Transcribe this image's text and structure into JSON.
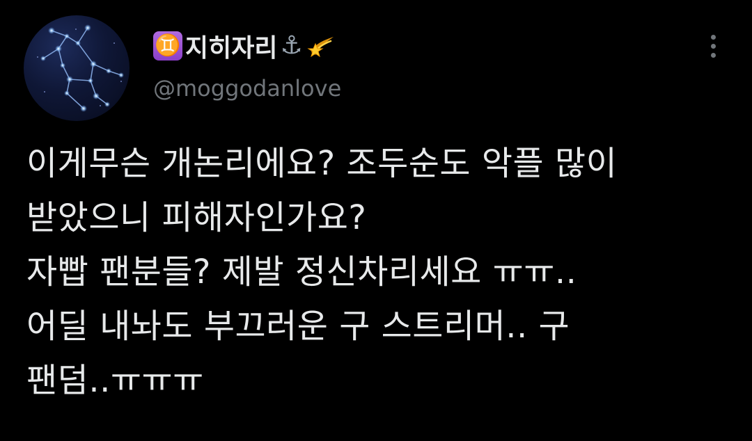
{
  "author": {
    "display_name": "♊지히자리⚓💫",
    "name_badge": "♊",
    "name_text": "지히자리",
    "name_anchor": "⚓",
    "name_emoji_icon": "dizzy-icon",
    "handle": "@moggodanlove",
    "avatar_icon": "gemini-constellation-avatar"
  },
  "menu": {
    "icon": "more-vertical-icon"
  },
  "tweet": {
    "lines": [
      "이게무슨 개논리에요? 조두순도 악플 많이",
      "받았으니 피해자인가요?",
      "자빱 팬분들? 제발 정신차리세요 ㅠㅠ..",
      "어딜 내놔도 부끄러운 구 스트리머.. 구",
      "팬덤..ㅠㅠㅠ"
    ]
  },
  "colors": {
    "background": "#000000",
    "text_primary": "#e7e9ea",
    "text_secondary": "#71767b",
    "badge_purple": "#9b51d6"
  }
}
